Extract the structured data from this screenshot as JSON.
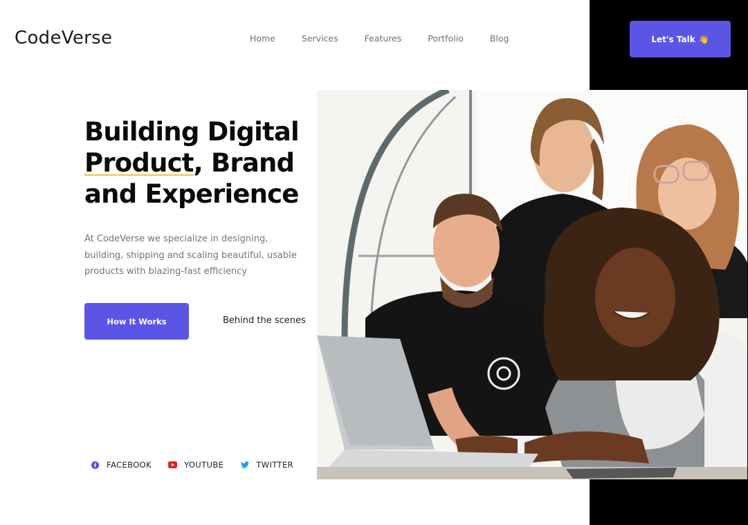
{
  "brand": {
    "logo_text": "CodeVerse"
  },
  "nav": {
    "items": [
      {
        "label": "Home"
      },
      {
        "label": "Services"
      },
      {
        "label": "Features"
      },
      {
        "label": "Portfolio"
      },
      {
        "label": "Blog"
      }
    ]
  },
  "header": {
    "cta_label": "Let's Talk",
    "cta_emoji": "👋"
  },
  "hero": {
    "headline_lines": [
      "Building Digital",
      "Product",
      ", Brand",
      "and Experience"
    ],
    "description": "At CodeVerse we specialize in designing, building, shipping and scaling beautiful, usable products with blazing-fast efficiency",
    "primary_button": "How It Works",
    "secondary_link": "Behind the scenes"
  },
  "socials": [
    {
      "label": "FACEBOOK",
      "icon": "facebook-icon"
    },
    {
      "label": "YOUTUBE",
      "icon": "youtube-icon"
    },
    {
      "label": "TWITTER",
      "icon": "twitter-icon"
    }
  ],
  "colors": {
    "accent": "#5b55e6",
    "underline": "#f2c23b",
    "facebook": "#4a4ee0",
    "youtube": "#e02424",
    "twitter": "#1da1f2",
    "black_panel": "#000000"
  }
}
